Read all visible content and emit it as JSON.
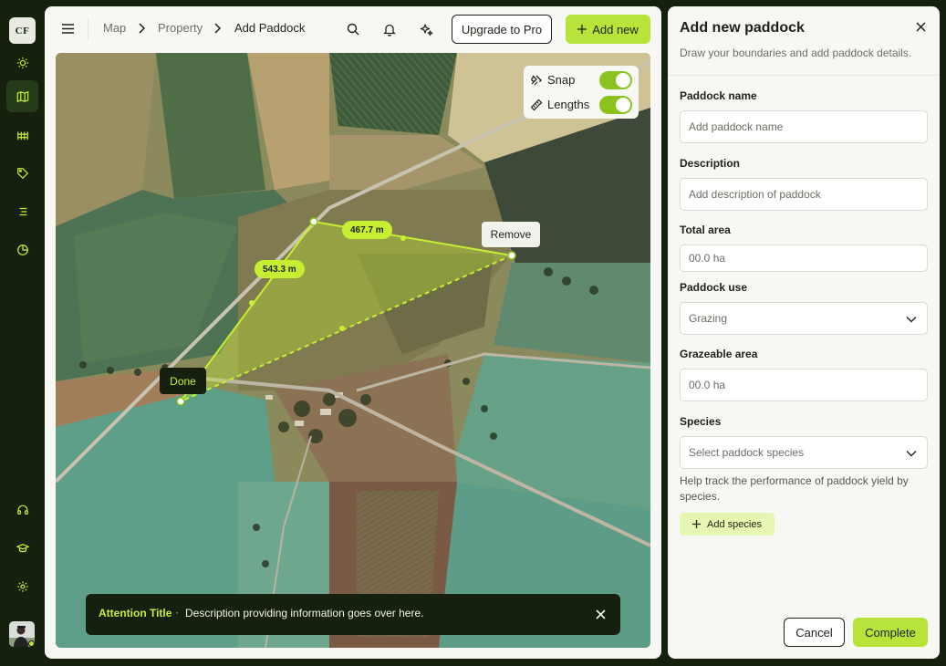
{
  "app": {
    "logo_text": "CF"
  },
  "rail": {
    "items": [
      {
        "icon": "sun-icon"
      },
      {
        "icon": "map-icon"
      },
      {
        "icon": "fence-icon"
      },
      {
        "icon": "tag-icon"
      },
      {
        "icon": "list-icon"
      },
      {
        "icon": "pie-chart-icon"
      }
    ],
    "bottom": [
      {
        "icon": "headset-icon"
      },
      {
        "icon": "graduation-cap-icon"
      },
      {
        "icon": "gear-icon"
      }
    ]
  },
  "breadcrumb": {
    "items": [
      "Map",
      "Property",
      "Add Paddock"
    ]
  },
  "header": {
    "upgrade_label": "Upgrade to Pro",
    "add_new_label": "Add new"
  },
  "map": {
    "snap_label": "Snap",
    "snap_on": true,
    "lengths_label": "Lengths",
    "lengths_on": true,
    "length_a": "467.7 m",
    "length_b": "543.3 m",
    "remove_label": "Remove",
    "done_label": "Done"
  },
  "toast": {
    "title": "Attention Title",
    "separator": "·",
    "description": "Description providing information goes over here."
  },
  "panel": {
    "title": "Add new paddock",
    "subtitle": "Draw your boundaries and add paddock details.",
    "name_label": "Paddock name",
    "name_placeholder": "Add paddock name",
    "desc_label": "Description",
    "desc_placeholder": "Add description of paddock",
    "area_label": "Total area",
    "area_placeholder": "00.0 ha",
    "use_label": "Paddock use",
    "use_value": "Grazing",
    "graze_label": "Grazeable area",
    "graze_placeholder": "00.0 ha",
    "species_label": "Species",
    "species_placeholder": "Select paddock species",
    "species_help": "Help track the performance of paddock yield by species.",
    "add_species_label": "Add species",
    "cancel_label": "Cancel",
    "complete_label": "Complete"
  },
  "colors": {
    "accent": "#b7e33a",
    "dark": "#15200f",
    "toggle": "#8bc31e"
  }
}
